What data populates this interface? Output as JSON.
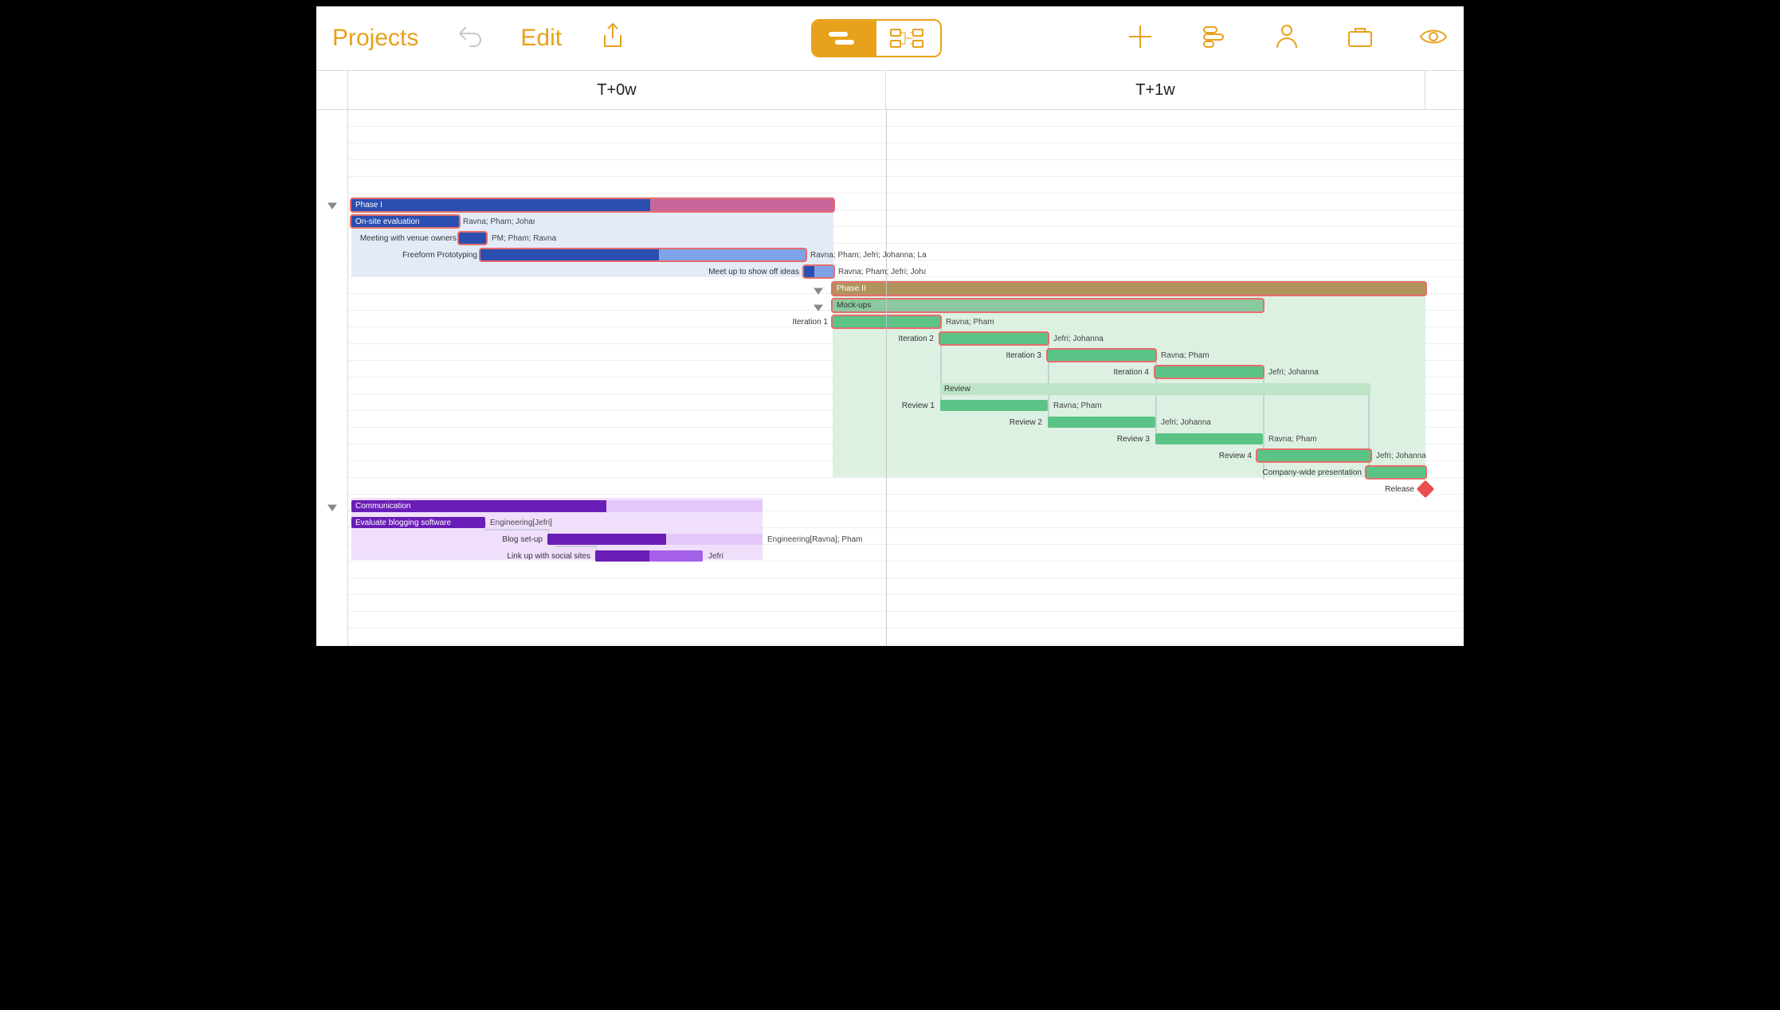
{
  "toolbar": {
    "projects": "Projects",
    "edit": "Edit"
  },
  "timeline": {
    "col0": "T+0w",
    "col1": "T+1w"
  },
  "groups": {
    "phase1": "Phase I",
    "phase2": "Phase II",
    "mockups": "Mock-ups",
    "review": "Review",
    "communication": "Communication"
  },
  "tasks": {
    "onsite": {
      "name": "On-site evaluation",
      "res": "Ravna; Pham; Johanna; PM"
    },
    "meeting": {
      "name": "Meeting with venue owners",
      "res": "PM; Pham; Ravna"
    },
    "proto": {
      "name": "Freeform Prototyping",
      "res": "Ravna; Pham; Jefri; Johanna; La"
    },
    "meetup": {
      "name": "Meet up to show off ideas",
      "res": "Ravna; Pham; Jefri; Johanna; PM"
    },
    "iter1": {
      "name": "Iteration 1",
      "res": "Ravna; Pham"
    },
    "iter2": {
      "name": "Iteration 2",
      "res": "Jefri; Johanna"
    },
    "iter3": {
      "name": "Iteration 3",
      "res": "Ravna; Pham"
    },
    "iter4": {
      "name": "Iteration 4",
      "res": "Jefri; Johanna"
    },
    "rev1": {
      "name": "Review 1",
      "res": "Ravna; Pham"
    },
    "rev2": {
      "name": "Review 2",
      "res": "Jefri; Johanna"
    },
    "rev3": {
      "name": "Review 3",
      "res": "Ravna; Pham"
    },
    "rev4": {
      "name": "Review 4",
      "res": "Jefri; Johanna"
    },
    "present": {
      "name": "Company-wide presentation"
    },
    "release": {
      "name": "Release"
    },
    "evalblog": {
      "name": "Evaluate blogging software",
      "res": "Engineering[Jefri]"
    },
    "blogsetup": {
      "name": "Blog set-up",
      "res": "Engineering[Ravna]; Pham"
    },
    "linkup": {
      "name": "Link up with social sites",
      "res": "Jefri"
    }
  }
}
